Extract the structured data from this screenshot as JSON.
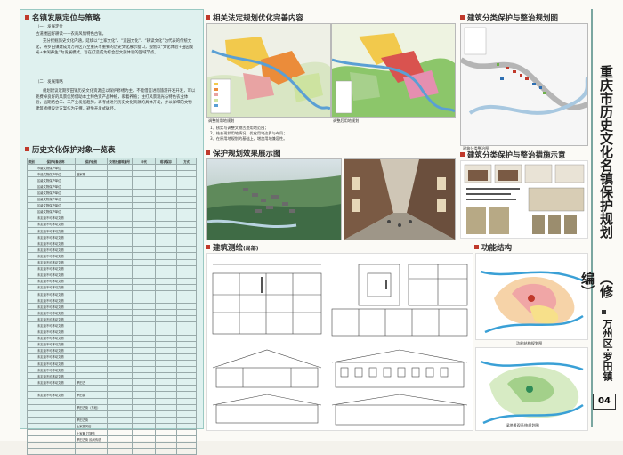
{
  "left": {
    "section1_title": "名镇发展定位与策略",
    "s1_sub1": "（一）发展定位",
    "s1_p1": "古道楼园好耕读——农商风情特色古镇。",
    "s1_p2": "充分挖掘历史文化内涵，延续以“土家文化”、“造园文化”、“耕读文化”为代表的传统文化，将罗田镇建成为万州区乃至重庆市重要的历史文化展示窗口，规划以“文化体验+田园观光+休闲养生”为发展模式，旨在打造成为综合型文旅体验的区域节点。",
    "s1_sub2": "（二）发展策略",
    "s1_p3": "规划建议近期罗田镇历史文化资源应以保护修缮为主，不能借鉴进而旅游开发开发，可以耗费掉良好的风景优势借助本土特色资产品种植，裹着养殖；注打风景观光与特色农业体验，远期结合二、三产业发展趋势，再考虑进行历史文化资源的具体开发，并以详细的文物建筑修缮设计方案作为支撑，避免开发式破坏。",
    "section2_title": "历史文化保护对象一览表",
    "table_headers": [
      "类别",
      "保护对象名称",
      "保护级别",
      "文物及建筑编号",
      "年代",
      "现状保存",
      "方式"
    ],
    "table_rows": [
      [
        "",
        "市级文物保护单位",
        "",
        "",
        "",
        "",
        ""
      ],
      [
        "",
        "市级文物保护单位",
        "盛家寨",
        "",
        "",
        "",
        ""
      ],
      [
        "",
        "区级文物保护单位",
        "",
        "",
        "",
        "",
        ""
      ],
      [
        "",
        "区级文物保护单位",
        "",
        "",
        "",
        "",
        ""
      ],
      [
        "",
        "区级文物保护单位",
        "",
        "",
        "",
        "",
        ""
      ],
      [
        "",
        "区级文物保护单位",
        "",
        "",
        "",
        "",
        ""
      ],
      [
        "",
        "区级文物保护单位",
        "",
        "",
        "",
        "",
        ""
      ],
      [
        "",
        "区级文物保护单位",
        "",
        "",
        "",
        "",
        ""
      ],
      [
        "",
        "未定级不可移动文物",
        "",
        "",
        "",
        "",
        ""
      ],
      [
        "",
        "未定级不可移动文物",
        "",
        "",
        "",
        "",
        ""
      ],
      [
        "",
        "未定级不可移动文物",
        "",
        "",
        "",
        "",
        ""
      ],
      [
        "",
        "未定级不可移动文物",
        "",
        "",
        "",
        "",
        ""
      ],
      [
        "",
        "未定级不可移动文物",
        "",
        "",
        "",
        "",
        ""
      ],
      [
        "",
        "未定级不可移动文物",
        "",
        "",
        "",
        "",
        ""
      ],
      [
        "",
        "未定级不可移动文物",
        "",
        "",
        "",
        "",
        ""
      ],
      [
        "",
        "未定级不可移动文物",
        "",
        "",
        "",
        "",
        ""
      ],
      [
        "",
        "未定级不可移动文物",
        "",
        "",
        "",
        "",
        ""
      ],
      [
        "",
        "未定级不可移动文物",
        "",
        "",
        "",
        "",
        ""
      ],
      [
        "",
        "未定级不可移动文物",
        "",
        "",
        "",
        "",
        ""
      ],
      [
        "",
        "未定级不可移动文物",
        "",
        "",
        "",
        "",
        ""
      ],
      [
        "",
        "未定级不可移动文物",
        "",
        "",
        "",
        "",
        ""
      ],
      [
        "",
        "未定级不可移动文物",
        "",
        "",
        "",
        "",
        ""
      ],
      [
        "",
        "未定级不可移动文物",
        "",
        "",
        "",
        "",
        ""
      ],
      [
        "",
        "未定级不可移动文物",
        "",
        "",
        "",
        "",
        ""
      ],
      [
        "",
        "未定级不可移动文物",
        "",
        "",
        "",
        "",
        ""
      ],
      [
        "",
        "未定级不可移动文物",
        "",
        "",
        "",
        "",
        ""
      ],
      [
        "",
        "未定级不可移动文物",
        "",
        "",
        "",
        "",
        ""
      ],
      [
        "",
        "未定级不可移动文物",
        "",
        "",
        "",
        "",
        ""
      ],
      [
        "",
        "未定级不可移动文物",
        "",
        "",
        "",
        "",
        ""
      ],
      [
        "",
        "未定级不可移动文物",
        "",
        "",
        "",
        "",
        ""
      ],
      [
        "",
        "未定级不可移动文物",
        "",
        "",
        "",
        "",
        ""
      ],
      [
        "",
        "未定级不可移动文物",
        "",
        "",
        "",
        "",
        ""
      ],
      [
        "",
        "未定级不可移动文物",
        "",
        "",
        "",
        "",
        ""
      ],
      [
        "",
        "未定级不可移动文物",
        "",
        "",
        "",
        "",
        ""
      ],
      [
        "",
        "未定级不可移动文物",
        "罗田古",
        "",
        "",
        "",
        ""
      ],
      [
        "",
        "",
        "",
        "",
        "",
        "",
        ""
      ],
      [
        "",
        "未定级不可移动文物",
        "罗田镇",
        "",
        "",
        "",
        ""
      ],
      [
        "",
        "",
        "",
        "",
        "",
        "",
        ""
      ],
      [
        "",
        "",
        "罗田古街（东段）",
        "",
        "",
        "",
        ""
      ],
      [
        "",
        "",
        "",
        "",
        "",
        "",
        ""
      ],
      [
        "",
        "",
        "罗田古街",
        "",
        "",
        "",
        ""
      ],
      [
        "",
        "",
        "土家族风俗",
        "",
        "",
        "",
        ""
      ],
      [
        "",
        "",
        "土家舞 打锣鼓",
        "",
        "",
        "",
        ""
      ],
      [
        "",
        "",
        "罗田古街 民间传说",
        "",
        "",
        "",
        ""
      ],
      [
        "",
        "",
        "",
        "",
        "",
        "",
        ""
      ],
      [
        "",
        "",
        "",
        "",
        "",
        "",
        ""
      ]
    ]
  },
  "mid": {
    "title_legal": "相关法定规划优化完善内容",
    "cap_map1": "调整前用地规划",
    "cap_map2": "调整后用地规划",
    "notes": [
      "1、核实与调整文物古迹用地范围；",
      "2、结合现状用地情况，优化用地边界与布局；",
      "3、在原用地规划的基础上，增加用地兼容性。"
    ],
    "title_effect": "保护规划效果展示图",
    "title_survey": "建筑测绘",
    "title_survey_suffix": "(局部)"
  },
  "right": {
    "title_class": "建筑分类保护与整治规划图",
    "cap_class": "建筑分类整治图",
    "title_measures": "建筑分类保护与整治措施示意",
    "title_function": "功能结构",
    "cap_func1": "功能结构规划图",
    "cap_func2": "绿地景观系统规划图"
  },
  "side": {
    "main_title": "重庆市历史文化名镇保护规划",
    "edition": "（修编）",
    "district": "万州区·罗田镇",
    "page_number": "04"
  },
  "colors": {
    "accent_red": "#c0392b",
    "panel_bg": "#dff1ef",
    "frame": "#7aa6a0"
  }
}
